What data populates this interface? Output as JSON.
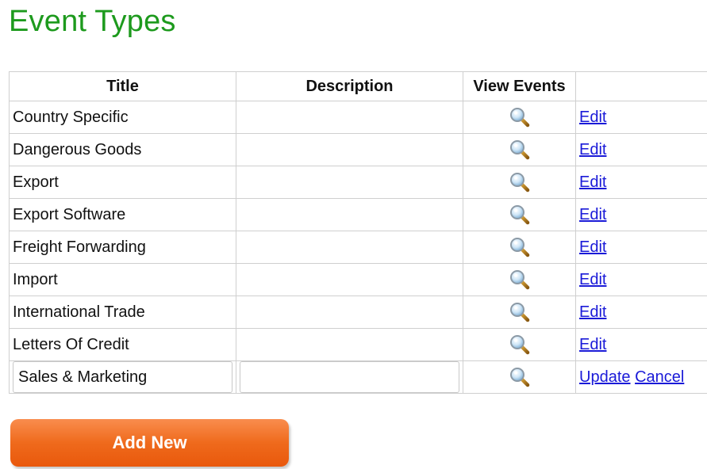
{
  "page": {
    "title": "Event Types"
  },
  "table": {
    "headers": {
      "title": "Title",
      "description": "Description",
      "view_events": "View Events",
      "actions": ""
    },
    "rows": [
      {
        "title": "Country Specific",
        "description": "",
        "view_icon": "magnifier-icon",
        "action": "Edit"
      },
      {
        "title": "Dangerous Goods",
        "description": "",
        "view_icon": "magnifier-icon",
        "action": "Edit"
      },
      {
        "title": "Export",
        "description": "",
        "view_icon": "magnifier-icon",
        "action": "Edit"
      },
      {
        "title": "Export Software",
        "description": "",
        "view_icon": "magnifier-icon",
        "action": "Edit"
      },
      {
        "title": "Freight Forwarding",
        "description": "",
        "view_icon": "magnifier-icon",
        "action": "Edit"
      },
      {
        "title": "Import",
        "description": "",
        "view_icon": "magnifier-icon",
        "action": "Edit"
      },
      {
        "title": "International Trade",
        "description": "",
        "view_icon": "magnifier-icon",
        "action": "Edit"
      },
      {
        "title": "Letters Of Credit",
        "description": "",
        "view_icon": "magnifier-icon",
        "action": "Edit"
      }
    ],
    "edit_row": {
      "title_value": "Sales & Marketing",
      "description_value": "",
      "view_icon": "magnifier-icon",
      "update_label": "Update",
      "cancel_label": "Cancel"
    }
  },
  "actions": {
    "add_new_label": "Add New"
  },
  "colors": {
    "title_green": "#1d9a1d",
    "link_blue": "#1a1ad8",
    "button_orange": "#ef6a1c",
    "grid_border": "#cfcfcf"
  }
}
